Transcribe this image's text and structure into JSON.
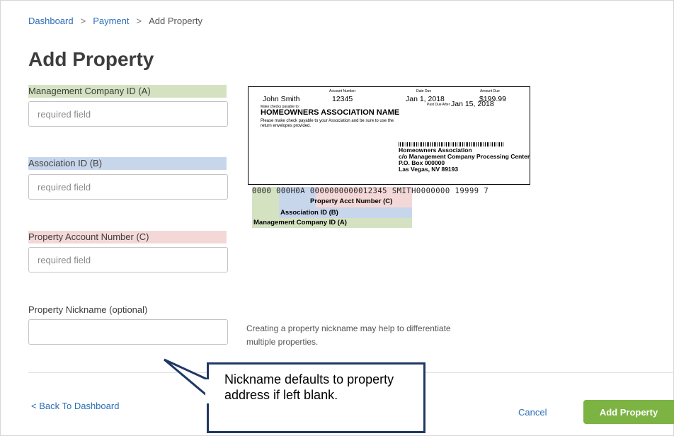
{
  "breadcrumb": {
    "items": [
      "Dashboard",
      "Payment",
      "Add Property"
    ],
    "separator": ">"
  },
  "page_title": "Add Property",
  "fields": [
    {
      "label": "Management Company ID (A)",
      "placeholder": "required field",
      "value": "",
      "highlight": "#d5e2c2"
    },
    {
      "label": "Association ID (B)",
      "placeholder": "required field",
      "value": "",
      "highlight": "#c8d6ec"
    },
    {
      "label": "Property Account Number (C)",
      "placeholder": "required field",
      "value": "",
      "highlight": "#f4d8d8"
    },
    {
      "label": "Property Nickname (optional)",
      "placeholder": "",
      "value": ""
    }
  ],
  "nickname_helper": "Creating a property nickname may help to differentiate multiple properties.",
  "statement": {
    "account_number_label": "Account Number",
    "date_due_label": "Date Due",
    "amount_due_label": "Amount Due",
    "name": "John Smith",
    "account_number": "12345",
    "date_due": "Jan 1, 2018",
    "amount_due": "$199.99",
    "payable_to_label": "Make checks payable to:",
    "payable_to": "HOMEOWNERS  ASSOCIATION NAME",
    "past_due_label": "Past Due After",
    "past_due_date": "Jan 15, 2018",
    "instructions": "Please make check payable to your Association and be sure to use the return envelopes provided.",
    "remit_address": [
      "Homeowners Association",
      "c/o Management Company Processing Center",
      "P.O. Box 000000",
      "Las Vegas, NV 89193"
    ],
    "ocr_line": "0000 000H0A 0000000000012345 SMITH0000000 19999 7",
    "legend": {
      "c": "Property Acct Number (C)",
      "b": "Association ID (B)",
      "a": "Management Company ID (A)"
    }
  },
  "callout_text": "Nickname defaults to property address if left blank.",
  "back_link": "< Back To Dashboard",
  "cancel_label": "Cancel",
  "submit_label": "Add Property",
  "colors": {
    "link": "#2b6fb5",
    "primary_button": "#7cb342",
    "highlight_a": "#d5e2c2",
    "highlight_b": "#c8d6ec",
    "highlight_c": "#f4d8d8",
    "callout_border": "#1f3864"
  }
}
